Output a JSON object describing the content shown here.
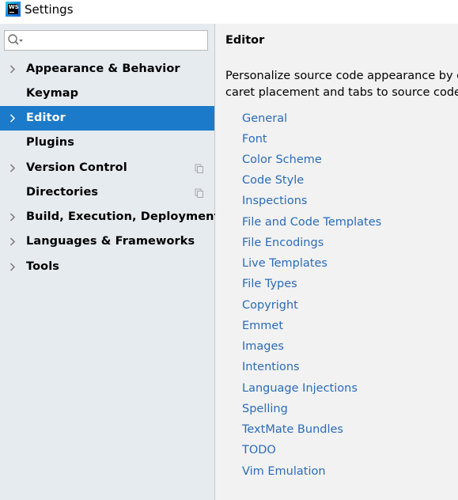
{
  "window": {
    "title": "Settings",
    "logo_text": "WS"
  },
  "search": {
    "value": "",
    "placeholder": ""
  },
  "sidebar": {
    "items": [
      {
        "label": "Appearance & Behavior",
        "expandable": true,
        "selected": false,
        "has_project_icon": false
      },
      {
        "label": "Keymap",
        "expandable": false,
        "selected": false,
        "has_project_icon": false
      },
      {
        "label": "Editor",
        "expandable": true,
        "selected": true,
        "has_project_icon": false
      },
      {
        "label": "Plugins",
        "expandable": false,
        "selected": false,
        "has_project_icon": false
      },
      {
        "label": "Version Control",
        "expandable": true,
        "selected": false,
        "has_project_icon": true
      },
      {
        "label": "Directories",
        "expandable": false,
        "selected": false,
        "has_project_icon": true
      },
      {
        "label": "Build, Execution, Deployment",
        "expandable": true,
        "selected": false,
        "has_project_icon": false
      },
      {
        "label": "Languages & Frameworks",
        "expandable": true,
        "selected": false,
        "has_project_icon": false
      },
      {
        "label": "Tools",
        "expandable": true,
        "selected": false,
        "has_project_icon": false
      }
    ]
  },
  "main": {
    "title": "Editor",
    "description_line1": "Personalize source code appearance by c",
    "description_line2": "caret placement and tabs to source code",
    "links": [
      "General",
      "Font",
      "Color Scheme",
      "Code Style",
      "Inspections",
      "File and Code Templates",
      "File Encodings",
      "Live Templates",
      "File Types",
      "Copyright",
      "Emmet",
      "Images",
      "Intentions",
      "Language Injections",
      "Spelling",
      "TextMate Bundles",
      "TODO",
      "Vim Emulation"
    ]
  },
  "colors": {
    "selection": "#1b7ac9",
    "link": "#2a6cb8",
    "sidebar_bg": "#e6ebf0",
    "panel_bg": "#f2f2f2"
  }
}
